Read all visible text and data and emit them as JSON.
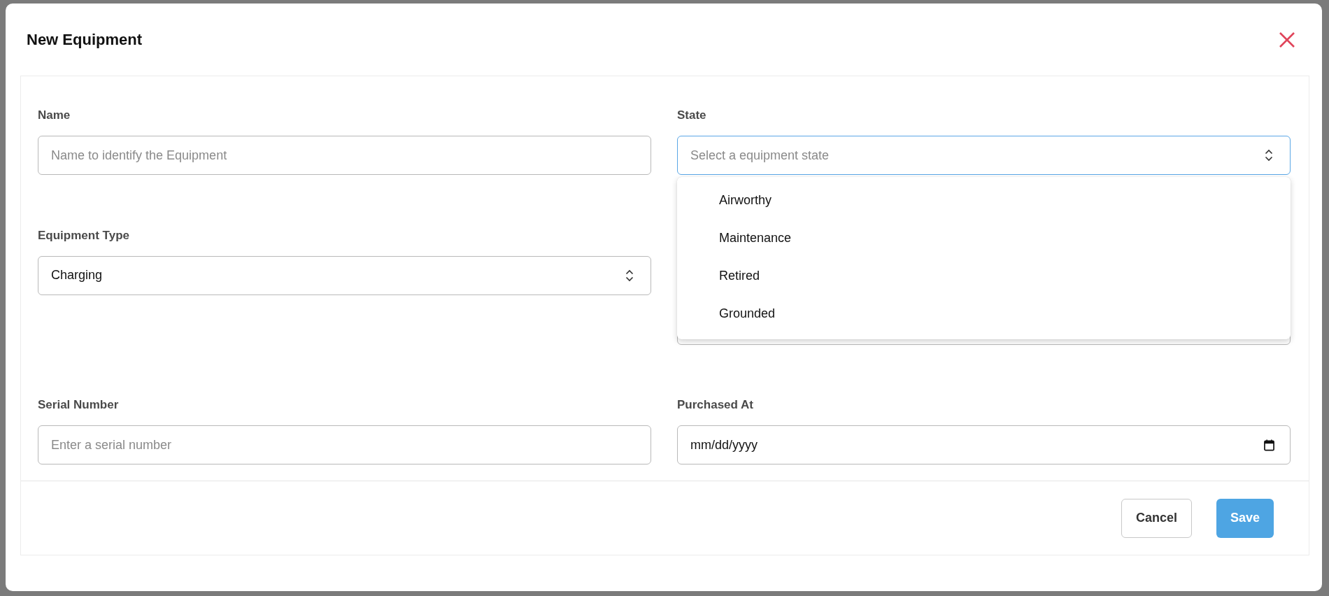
{
  "dialog": {
    "title": "New Equipment"
  },
  "fields": [
    {
      "kind": "text",
      "label": "Name",
      "placeholder": "Name to identify the Equipment"
    },
    {
      "kind": "select",
      "label": "State",
      "placeholder": "Select a equipment state",
      "focused": true,
      "expanded": true,
      "options": [
        {
          "label": "Airworthy",
          "selected": false
        },
        {
          "label": "Maintenance",
          "selected": false
        },
        {
          "label": "Retired",
          "selected": false
        },
        {
          "label": "Grounded",
          "selected": false
        }
      ]
    },
    {
      "kind": "select",
      "label": "Equipment Type",
      "value": "Charging",
      "focused": false
    },
    {
      "kind": "covered"
    },
    {
      "kind": "text",
      "label": "Serial Number",
      "placeholder": "Enter a serial number"
    },
    {
      "kind": "date",
      "label": "Purchased At",
      "value": "mm/dd/yyyy"
    }
  ],
  "buttons": [
    {
      "label": "Cancel",
      "kind": "secondary"
    },
    {
      "label": "Save",
      "kind": "primary"
    }
  ]
}
